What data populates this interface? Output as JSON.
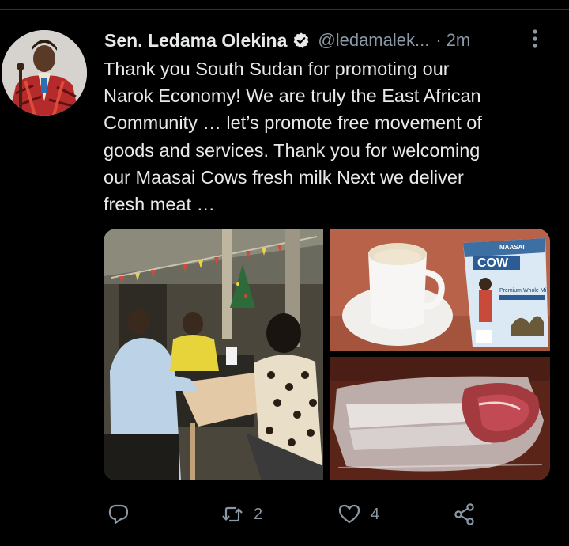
{
  "tweet": {
    "display_name": "Sen. Ledama Olekina",
    "handle": "@ledamalek...",
    "separator": "·",
    "time": "2m",
    "text": "Thank you South Sudan for promoting our\nNarok Economy! We are truly the East African\nCommunity … let’s promote free movement of\ngoods and services. Thank you for welcoming\nour Maasai Cows fresh milk Next we deliver\nfresh meat …"
  },
  "media": {
    "milk_pack_brand": "COW",
    "milk_pack_subtitle": "Premium Whole Mi",
    "milk_pack_top": "MAASAI"
  },
  "actions": {
    "reply_count": "",
    "retweet_count": "2",
    "like_count": "4"
  },
  "icons": {
    "verified": "verified-badge-icon",
    "more": "more-vertical-icon",
    "reply": "reply-icon",
    "retweet": "retweet-icon",
    "like": "heart-icon",
    "share": "share-icon"
  },
  "colors": {
    "background": "#000000",
    "text": "#e7e9ea",
    "secondary": "#8b98a5"
  }
}
